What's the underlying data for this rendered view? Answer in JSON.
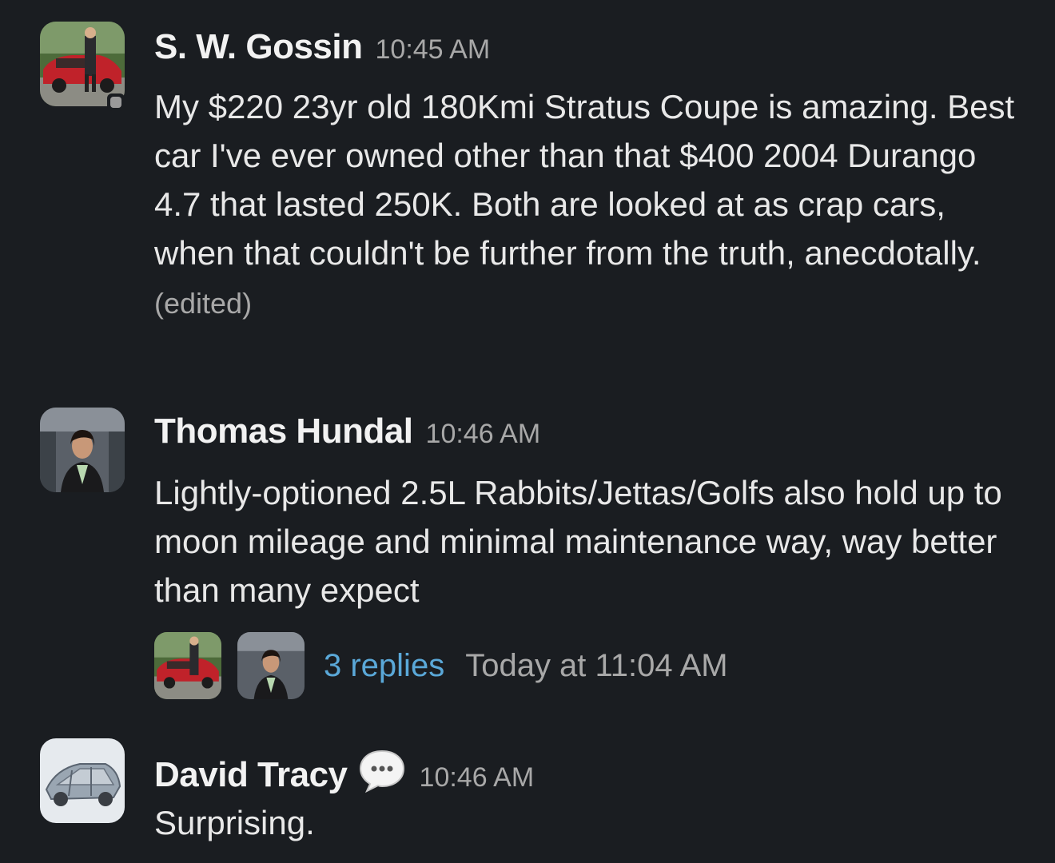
{
  "messages": [
    {
      "author": "S. W. Gossin",
      "time": "10:45 AM",
      "text": "My $220 23yr old 180Kmi Stratus Coupe is amazing. Best car I've ever owned other than that $400 2004 Durango 4.7 that lasted 250K. Both are looked at as crap cars, when that couldn't be further from the truth, anecdotally.",
      "edited_label": "(edited)",
      "avatar_icon": "red-car-photo-avatar",
      "presence": "away"
    },
    {
      "author": "Thomas Hundal",
      "time": "10:46 AM",
      "text": "Lightly-optioned 2.5L Rabbits/Jettas/Golfs also hold up to moon mileage and minimal maintenance way, way better than many expect",
      "avatar_icon": "person-photo-avatar",
      "thread": {
        "replies_label": "3 replies",
        "last_reply_label": "Today at 11:04 AM"
      }
    },
    {
      "author": "David Tracy",
      "time": "10:46 AM",
      "text": "Surprising.",
      "avatar_icon": "car-chassis-photo-avatar",
      "status_icon": "speech-bubble-icon"
    }
  ],
  "colors": {
    "background": "#1a1d21",
    "text": "#e8e8e8",
    "muted": "#a8a8a8",
    "link": "#5aa8d8"
  }
}
